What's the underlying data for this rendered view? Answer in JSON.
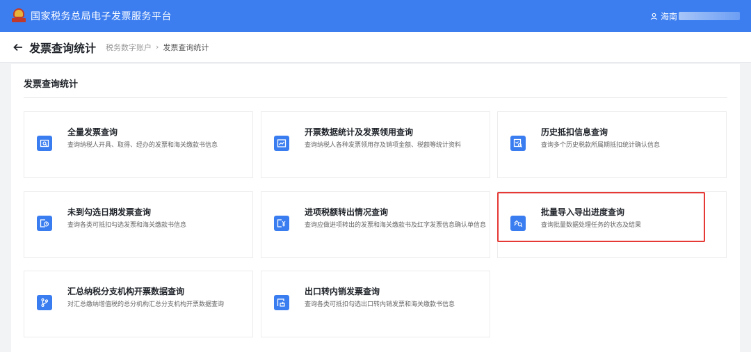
{
  "app": {
    "title": "国家税务总局电子发票服务平台",
    "user_name": "海南"
  },
  "page": {
    "title": "发票查询统计",
    "breadcrumb": [
      "税务数字账户",
      "发票查询统计"
    ]
  },
  "panel": {
    "title": "发票查询统计"
  },
  "cards": [
    {
      "title": "全量发票查询",
      "desc": "查询纳税人开具、取得、经办的发票和海关缴款书信息",
      "icon": "invoice-search-icon"
    },
    {
      "title": "开票数据统计及发票领用查询",
      "desc": "查询纳税人各种发票领用存及销项金额、税额等统计资料",
      "icon": "chart-trend-icon"
    },
    {
      "title": "历史抵扣信息查询",
      "desc": "查询多个历史税款所属期抵扣统计确认信息",
      "icon": "history-search-icon"
    },
    {
      "title": "未到勾选日期发票查询",
      "desc": "查询各类可抵扣勾选发票和海关缴款书信息",
      "icon": "clock-invoice-icon"
    },
    {
      "title": "进项税额转出情况查询",
      "desc": "查询应做进项转出的发票和海关缴款书及红字发票信息确认单信息",
      "icon": "yen-invoice-icon"
    },
    {
      "title": "批量导入导出进度查询",
      "desc": "查询批量数据处理任务的状态及结果",
      "icon": "batch-search-icon"
    },
    {
      "title": "汇总纳税分支机构开票数据查询",
      "desc": "对汇总缴纳增值税的总分机构汇总分支机构开票数据查询",
      "icon": "branch-icon"
    },
    {
      "title": "出口转内销发票查询",
      "desc": "查询各类可抵扣勾选出口转内销发票和海关缴款书信息",
      "icon": "export-invoice-icon"
    }
  ],
  "colors": {
    "header": "#3c7ef0",
    "icon_bg": "#3a7df0",
    "highlight": "#e53935"
  }
}
